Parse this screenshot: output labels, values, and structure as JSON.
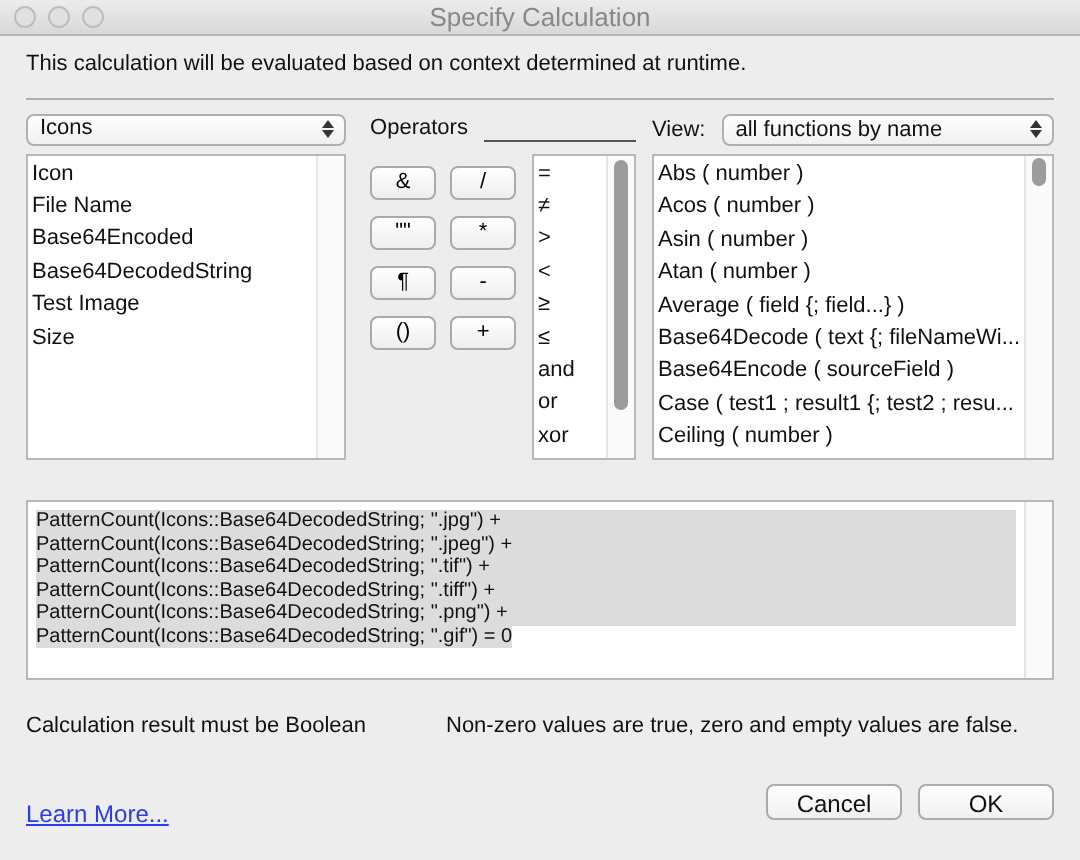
{
  "window": {
    "title": "Specify Calculation"
  },
  "context_note": "This calculation will be evaluated based on context determined at runtime.",
  "table_select": {
    "value": "Icons"
  },
  "fields": [
    {
      "label": "Icon"
    },
    {
      "label": "File Name"
    },
    {
      "label": "Base64Encoded"
    },
    {
      "label": "Base64DecodedString"
    },
    {
      "label": "Test Image"
    },
    {
      "label": "Size"
    }
  ],
  "operators_label": "Operators",
  "operator_buttons": [
    "&",
    "/",
    "\"\"",
    "*",
    "¶",
    "-",
    "()",
    "+"
  ],
  "operator_list": [
    "=",
    "≠",
    ">",
    "<",
    "≥",
    "≤",
    "and",
    "or",
    "xor"
  ],
  "view_label": "View:",
  "view_select": {
    "value": "all functions by name"
  },
  "functions": [
    "Abs ( number )",
    "Acos ( number )",
    "Asin ( number )",
    "Atan ( number )",
    "Average ( field {; field...} )",
    "Base64Decode ( text {; fileNameWi...",
    "Base64Encode ( sourceField )",
    "Case ( test1 ; result1 {; test2 ; resu...",
    "Ceiling ( number )"
  ],
  "calculation": {
    "selected": true,
    "lines": [
      "PatternCount(Icons::Base64DecodedString; \".jpg\") +",
      "PatternCount(Icons::Base64DecodedString; \".jpeg\") +",
      "PatternCount(Icons::Base64DecodedString; \".tif\") +",
      "PatternCount(Icons::Base64DecodedString; \".tiff\") +",
      "PatternCount(Icons::Base64DecodedString; \".png\") +",
      "PatternCount(Icons::Base64DecodedString; \".gif\") = 0"
    ]
  },
  "result_type": "Calculation result must be Boolean",
  "result_note": "Non-zero values are true, zero and empty values are false.",
  "learn_more": "Learn More...",
  "buttons": [
    "Cancel",
    "OK"
  ]
}
